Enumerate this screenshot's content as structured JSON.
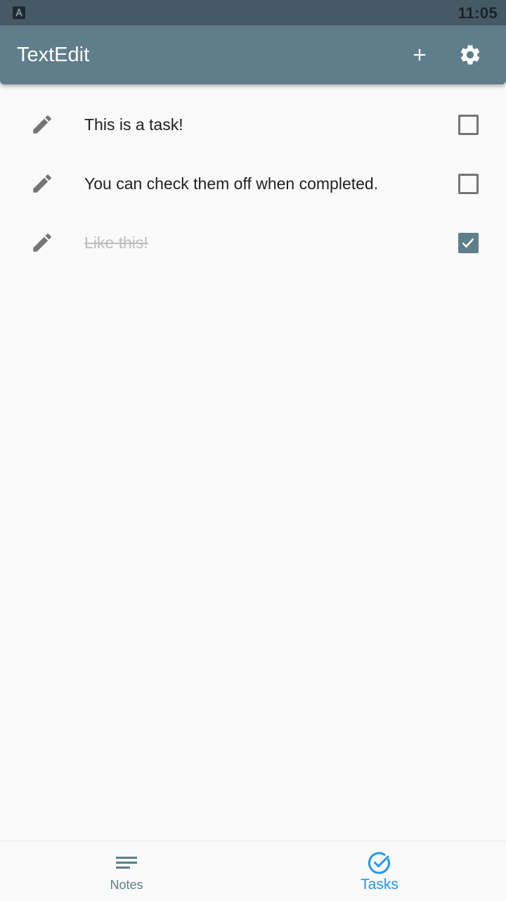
{
  "status_bar": {
    "time": "11:05",
    "app_icon": "a-letter-icon"
  },
  "app_bar": {
    "title": "TextEdit",
    "actions": [
      {
        "name": "add",
        "icon": "plus-icon"
      },
      {
        "name": "settings",
        "icon": "gear-icon"
      }
    ]
  },
  "tasks": [
    {
      "text": "This is a task!",
      "completed": false
    },
    {
      "text": "You can check them off when completed.",
      "completed": false
    },
    {
      "text": "Like this!",
      "completed": true
    }
  ],
  "bottom_nav": {
    "items": [
      {
        "label": "Notes",
        "icon": "notes-lines-icon",
        "active": false
      },
      {
        "label": "Tasks",
        "icon": "check-circle-icon",
        "active": true
      }
    ]
  },
  "colors": {
    "status_bar": "#455a64",
    "app_bar": "#607d8b",
    "background": "#fafafa",
    "active_tab": "#2196f3",
    "inactive_tab": "#607d8b",
    "checkbox_checked": "#607d8b",
    "completed_text": "#bdbdbd"
  }
}
